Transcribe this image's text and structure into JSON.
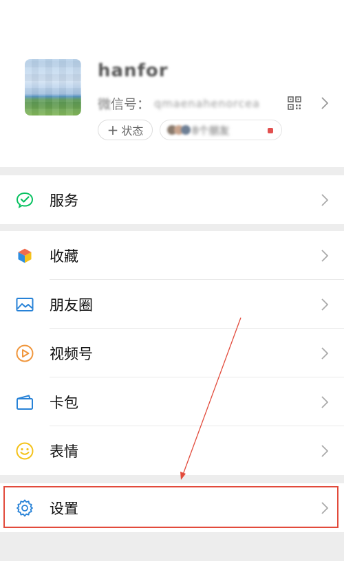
{
  "profile": {
    "nickname": "hanfor",
    "wxid_label_blurred": "微",
    "wxid_label": "信号：",
    "wxid_value": "qmaenahenorcea",
    "status_label": "状态",
    "friend_status_text": "8个朋友"
  },
  "menu": {
    "services": {
      "label": "服务",
      "icon": "wechat-pay-icon",
      "color": "#07c160"
    },
    "favorites": {
      "label": "收藏",
      "icon": "cube-icon"
    },
    "moments": {
      "label": "朋友圈",
      "icon": "picture-icon",
      "color": "#2782d7"
    },
    "channels": {
      "label": "视频号",
      "icon": "play-circle-icon",
      "color": "#f0963c"
    },
    "cards": {
      "label": "卡包",
      "icon": "wallet-icon",
      "color": "#2782d7"
    },
    "stickers": {
      "label": "表情",
      "icon": "smile-icon",
      "color": "#f4c21a"
    },
    "settings": {
      "label": "设置",
      "icon": "gear-icon",
      "color": "#2782d7"
    }
  },
  "annotation": {
    "color": "#e24a3b"
  }
}
